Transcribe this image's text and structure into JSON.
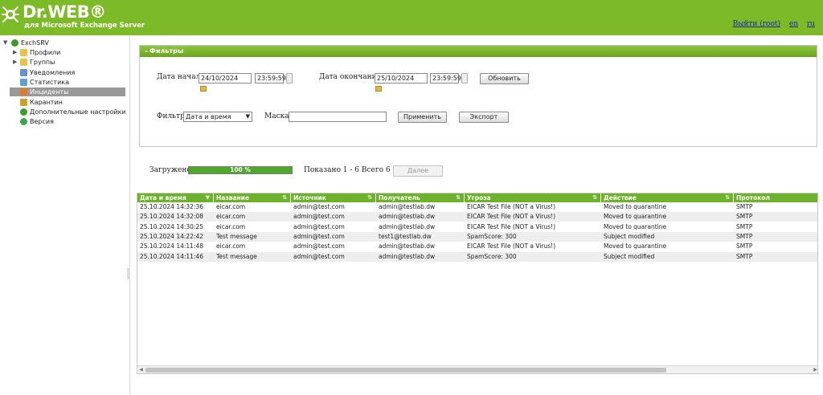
{
  "header": {
    "brand": "Dr.WEB®",
    "subtitle": "для Microsoft Exchange Server",
    "links": {
      "logout": "Выйти (root)",
      "lang_en": "en",
      "lang_ru": "ru"
    },
    "colors": {
      "brand_green": "#7dba27"
    }
  },
  "sidebar": {
    "root": {
      "label": "ExchSRV",
      "icon": "server-icon",
      "expanded": true
    },
    "items": [
      {
        "label": "Профили",
        "icon": "folder-icon",
        "expandable": true
      },
      {
        "label": "Группы",
        "icon": "folder-icon",
        "expandable": true
      },
      {
        "label": "Уведомления",
        "icon": "notification-icon",
        "expandable": false
      },
      {
        "label": "Статистика",
        "icon": "statistics-icon",
        "expandable": false
      },
      {
        "label": "Инциденты",
        "icon": "incident-icon",
        "expandable": false,
        "selected": true
      },
      {
        "label": "Карантин",
        "icon": "quarantine-icon",
        "expandable": false
      },
      {
        "label": "Дополнительные настройки",
        "icon": "settings-icon",
        "expandable": false
      },
      {
        "label": "Версия",
        "icon": "info-icon",
        "expandable": false
      }
    ]
  },
  "filters": {
    "title": "Фильтры",
    "start_label": "Дата начала",
    "start_date": "24/10/2024",
    "start_time": "23:59:59",
    "end_label": "Дата окончания",
    "end_date": "25/10/2024",
    "end_time": "23:59:59",
    "refresh_button": "Обновить",
    "filter_label": "Фильтр",
    "filter_value": "Дата и время",
    "mask_label": "Маска",
    "mask_value": "",
    "apply_button": "Применить",
    "export_button": "Экспорт"
  },
  "status": {
    "loaded_label": "Загружено",
    "progress_text": "100 %",
    "progress_fraction": 1.0,
    "shown_text": "Показано 1 - 6 Всего 6",
    "next_button": "Далее"
  },
  "table": {
    "columns": [
      "Дата и время",
      "Название",
      "Источник",
      "Получатель",
      "Угроза",
      "Действие",
      "Протокол"
    ],
    "rows": [
      [
        "25.10.2024 14:32:36",
        "eicar.com",
        "admin@test.com",
        "admin@testlab.dw",
        "EICAR Test File (NOT a Virus!)",
        "Moved to quarantine",
        "SMTP"
      ],
      [
        "25.10.2024 14:32:08",
        "eicar.com",
        "admin@test.com",
        "admin@testlab.dw",
        "EICAR Test File (NOT a Virus!)",
        "Moved to quarantine",
        "SMTP"
      ],
      [
        "25.10.2024 14:30:25",
        "eicar.com",
        "admin@test.com",
        "admin@testlab.dw",
        "EICAR Test File (NOT a Virus!)",
        "Moved to quarantine",
        "SMTP"
      ],
      [
        "25.10.2024 14:22:42",
        "Test message",
        "admin@test.com",
        "test1@testlab.dw",
        "SpamScore: 300",
        "Subject modified",
        "SMTP"
      ],
      [
        "25.10.2024 14:11:48",
        "eicar.com",
        "admin@test.com",
        "admin@testlab.dw",
        "EICAR Test File (NOT a Virus!)",
        "Moved to quarantine",
        "SMTP"
      ],
      [
        "25.10.2024 14:11:46",
        "Test message",
        "admin@test.com",
        "admin@testlab.dw",
        "SpamScore: 300",
        "Subject modified",
        "SMTP"
      ]
    ]
  }
}
